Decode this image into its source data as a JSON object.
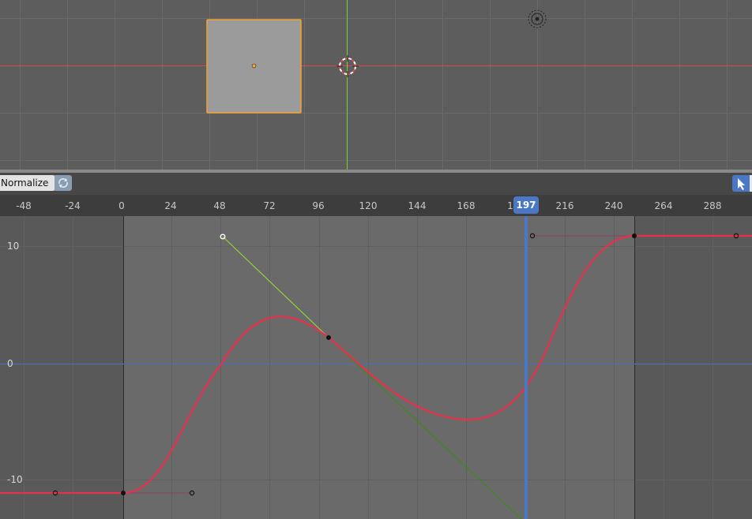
{
  "header": {
    "normalize_label": "Normalize",
    "cycle_icon": "refresh-icon",
    "select_icon": "cursor-arrow-icon"
  },
  "ruler": {
    "ticks": [
      "-48",
      "-24",
      "0",
      "24",
      "48",
      "72",
      "96",
      "120",
      "144",
      "168",
      "1",
      "216",
      "240",
      "264",
      "288"
    ],
    "current_frame": "197"
  },
  "graph": {
    "y_labels": [
      "10",
      "0",
      "-10"
    ],
    "curve_color": "#e8304a",
    "handle_selected_color": "#7ed321",
    "playhead_color": "#4a78c7"
  },
  "viewport": {
    "object": "cube",
    "selection_color": "#f5a030",
    "x_axis_color": "#d94a4a",
    "y_axis_color": "#7ecf2a"
  }
}
